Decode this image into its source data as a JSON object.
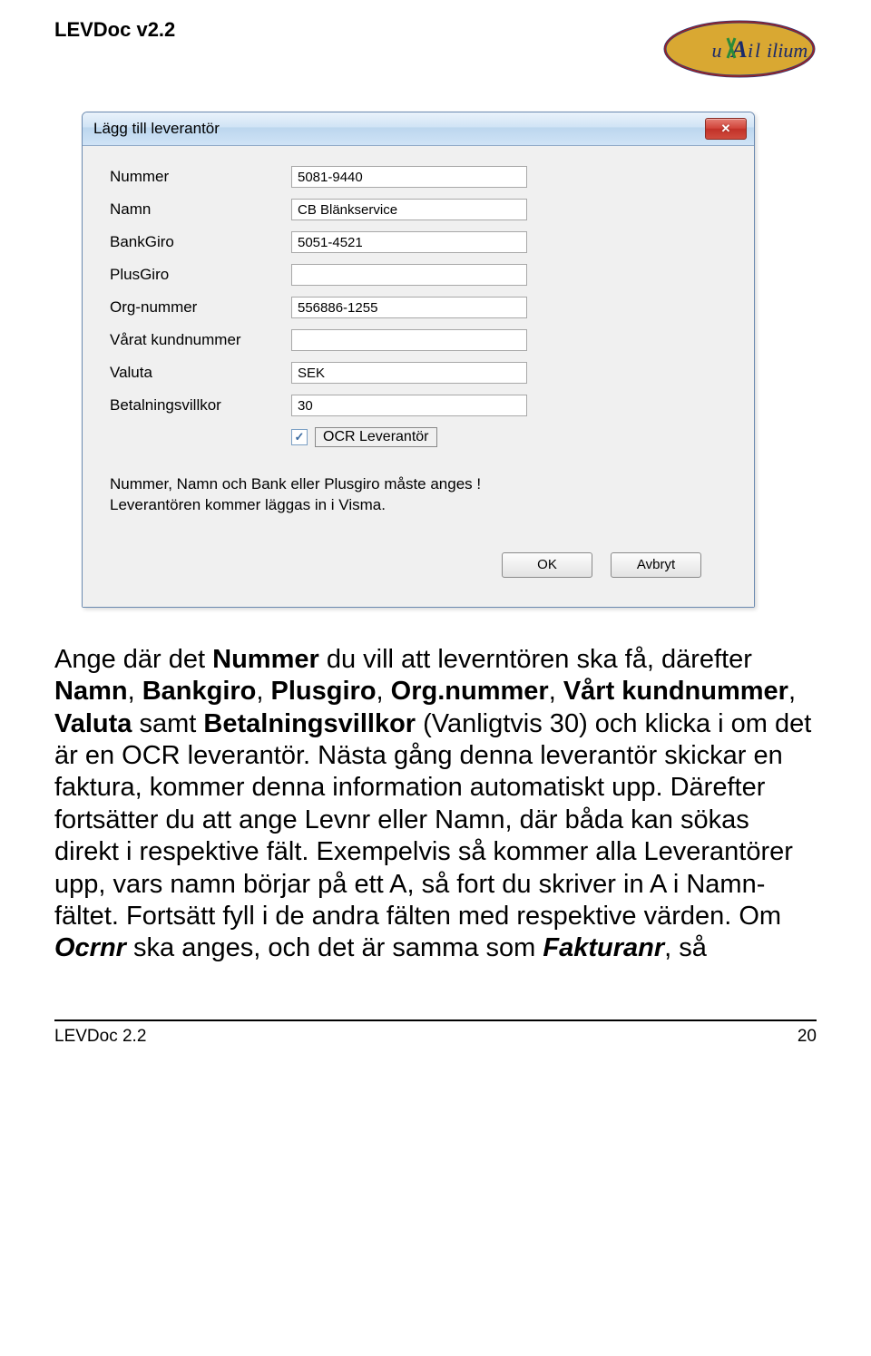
{
  "header": {
    "title": "LEVDoc v2.2",
    "logo_text": "Auxilium"
  },
  "window": {
    "title": "Lägg till leverantör",
    "close_label": "X",
    "fields": {
      "nummer": {
        "label": "Nummer",
        "value": "5081-9440"
      },
      "namn": {
        "label": "Namn",
        "value": "CB Blänkservice"
      },
      "bankgiro": {
        "label": "BankGiro",
        "value": "5051-4521"
      },
      "plusgiro": {
        "label": "PlusGiro",
        "value": ""
      },
      "orgnr": {
        "label": "Org-nummer",
        "value": "556886-1255"
      },
      "kundnr": {
        "label": "Vårat kundnummer",
        "value": ""
      },
      "valuta": {
        "label": "Valuta",
        "value": "SEK"
      },
      "villkor": {
        "label": "Betalningsvillkor",
        "value": "30"
      }
    },
    "ocr": {
      "checked": true,
      "label": "OCR Leverantör"
    },
    "hint_line1": "Nummer, Namn och Bank eller Plusgiro måste anges !",
    "hint_line2": "Leverantören kommer läggas in i Visma.",
    "ok_label": "OK",
    "cancel_label": "Avbryt"
  },
  "body": {
    "p1_a": "Ange där det ",
    "p1_b": "Nummer",
    "p1_c": " du vill att leverntören ska få, därefter ",
    "p1_d": "Namn",
    "p1_e": ", ",
    "p1_f": "Bankgiro",
    "p1_g": ", ",
    "p1_h": "Plusgiro",
    "p1_i": ", ",
    "p1_j": "Org.nummer",
    "p1_k": ", ",
    "p1_l": "Vårt kundnummer",
    "p1_m": ", ",
    "p1_n": "Valuta",
    "p1_o": " samt ",
    "p1_p": "Betalningsvillkor",
    "p1_q": " (Vanligtvis 30) och klicka i om det är en OCR leverantör. Nästa gång denna leverantör skickar en faktura, kommer denna information automatiskt upp. Därefter fortsätter du att ange Levnr eller Namn, där båda kan sökas direkt i respektive fält. Exempelvis så kommer alla Leverantörer upp, vars namn börjar på ett A, så fort du skriver in A i Namn-fältet. Fortsätt fyll i de andra fälten med respektive värden. Om ",
    "p1_r": "Ocrnr",
    "p1_s": " ska anges, och det är samma som ",
    "p1_t": "Fakturanr",
    "p1_u": ", så"
  },
  "footer": {
    "left": "LEVDoc 2.2",
    "right": "20"
  }
}
